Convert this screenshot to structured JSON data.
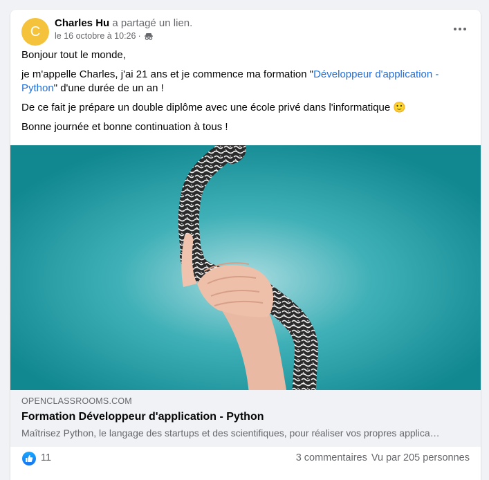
{
  "post": {
    "author_name": "Charles Hu",
    "author_initial": "C",
    "action": " a partagé un lien.",
    "date": "le 16 octobre à 10:26",
    "separator": "·",
    "more_label": "•••",
    "avatar_color": "#f5c33b"
  },
  "message": {
    "line1": "Bonjour tout le monde,",
    "line2_before": "je m'appelle Charles, j'ai 21 ans et je commence ma formation \"",
    "line2_link": "Développeur d'application - Python",
    "line2_after": "\" d'une durée de un an !",
    "line3": "De ce fait je prépare un double diplôme avec une école privé dans l'informatique ",
    "line3_emoji": "🙂",
    "line4": "Bonne journée et bonne continuation à tous !"
  },
  "link_preview": {
    "domain": "OPENCLASSROOMS.COM",
    "title": "Formation Développeur d'application - Python",
    "description": "Maîtrisez Python, le langage des startups et des scientifiques, pour réaliser vos propres applica…"
  },
  "reactions": {
    "like_count": "11",
    "comments": "3 commentaires",
    "views": "Vu par 205 personnes"
  },
  "colors": {
    "link": "#216fdb",
    "like_blue": "#1774f2",
    "image_bg": "#178b93"
  }
}
